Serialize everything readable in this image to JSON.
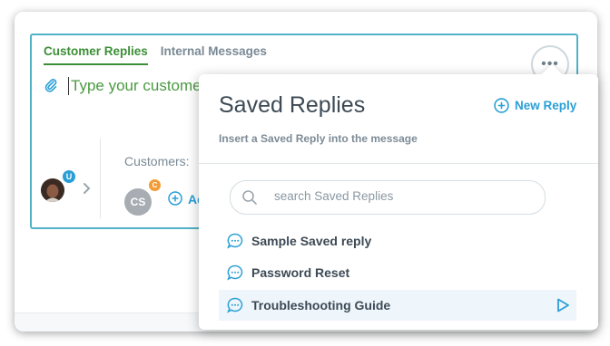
{
  "composer": {
    "tabs": [
      {
        "label": "Customer Replies"
      },
      {
        "label": "Internal Messages"
      }
    ],
    "message_placeholder": "Type your customer reply here...",
    "more_label": "•••",
    "assignee_badge": "U",
    "customers_label": "Customers:",
    "customer_initials": "CS",
    "customer_badge": "C",
    "add_label": "Add"
  },
  "saved_replies": {
    "title": "Saved Replies",
    "new_reply_label": "New Reply",
    "subtitle": "Insert a Saved Reply into the message",
    "search_placeholder": "search Saved Replies",
    "items": [
      {
        "label": "Sample Saved reply"
      },
      {
        "label": "Password Reset"
      },
      {
        "label": "Troubleshooting Guide"
      }
    ]
  },
  "colors": {
    "accent_green": "#3c8f36",
    "accent_blue": "#2a9fd6",
    "border_teal": "#4fb2c7",
    "badge_orange": "#f39c35"
  }
}
